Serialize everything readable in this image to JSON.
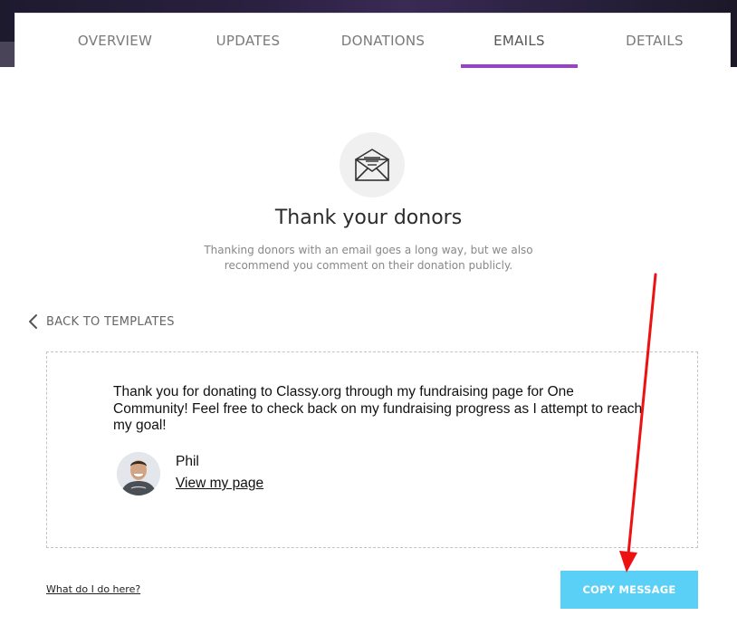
{
  "tabs": [
    {
      "label": "OVERVIEW",
      "active": false
    },
    {
      "label": "UPDATES",
      "active": false
    },
    {
      "label": "DONATIONS",
      "active": false
    },
    {
      "label": "EMAILS",
      "active": true
    },
    {
      "label": "DETAILS",
      "active": false
    }
  ],
  "colors": {
    "active_tab_underline": "#9b3fcf",
    "copy_button": "#5bd0f7",
    "annotation_arrow": "#ee1111"
  },
  "intro": {
    "icon": "envelope-icon",
    "heading": "Thank your donors",
    "subtext": "Thanking donors with an email goes a long way, but we also recommend you comment on their donation publicly."
  },
  "back_link": {
    "icon": "chevron-left-icon",
    "label": "BACK TO TEMPLATES"
  },
  "message": {
    "body": "Thank you for donating to Classy.org through my fundraising page for One Community! Feel free to check back on my fundraising progress as I attempt to reach my goal!",
    "sender_name": "Phil",
    "view_link": "View my page"
  },
  "footer": {
    "help_link": "What do I do here?",
    "copy_button": "COPY MESSAGE"
  }
}
